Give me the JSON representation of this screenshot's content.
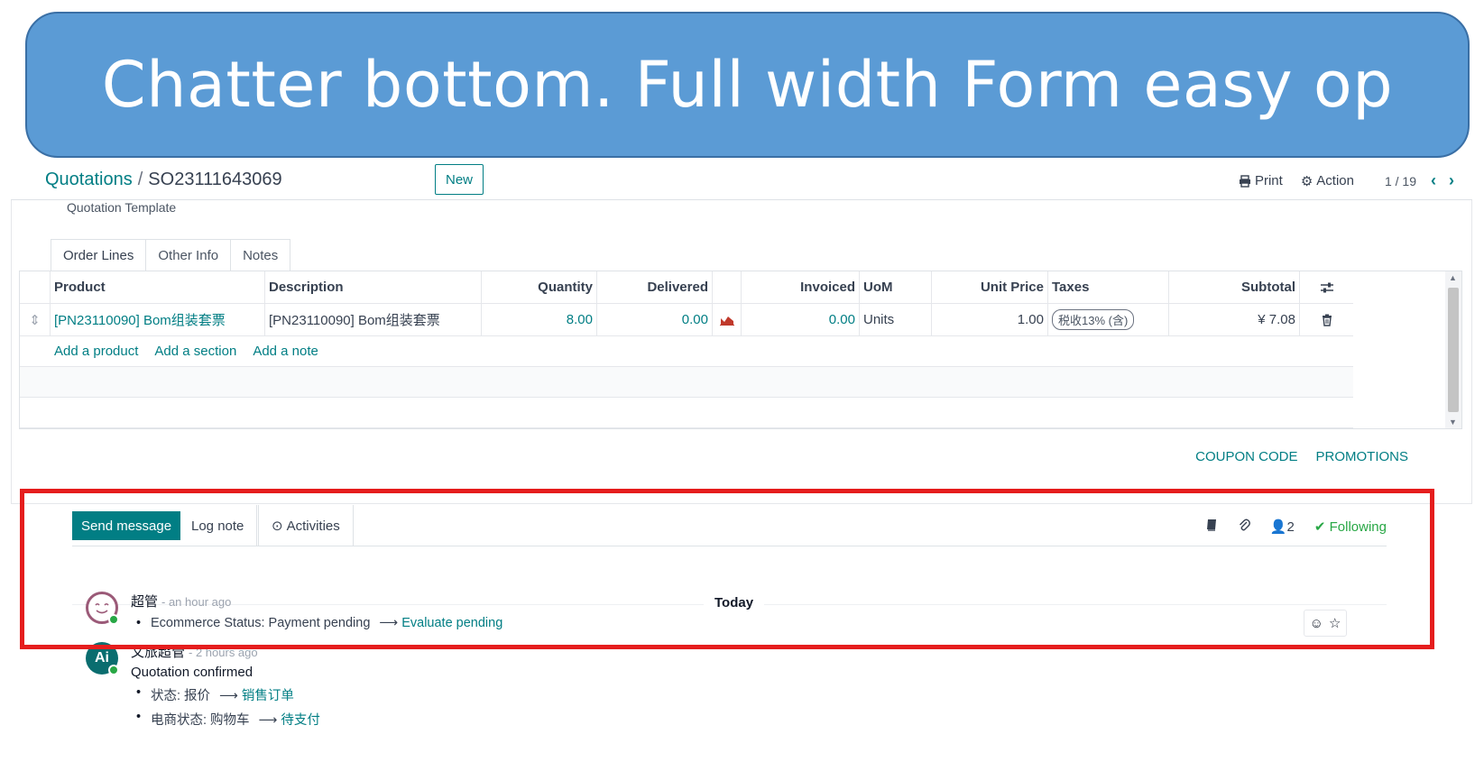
{
  "banner": {
    "text": "Chatter bottom. Full width Form easy op"
  },
  "breadcrumb": {
    "parent": "Quotations",
    "separator": "/",
    "current": "SO23111643069"
  },
  "control": {
    "new_label": "New",
    "print_label": "Print",
    "action_label": "Action",
    "pager": "1 / 19"
  },
  "form": {
    "template_label": "Quotation Template",
    "tabs": [
      {
        "label": "Order Lines",
        "active": true
      },
      {
        "label": "Other Info",
        "active": false
      },
      {
        "label": "Notes",
        "active": false
      }
    ]
  },
  "table": {
    "headers": {
      "product": "Product",
      "description": "Description",
      "quantity": "Quantity",
      "delivered": "Delivered",
      "invoiced": "Invoiced",
      "uom": "UoM",
      "unit_price": "Unit Price",
      "taxes": "Taxes",
      "subtotal": "Subtotal"
    },
    "row": {
      "product": "[PN23110090] Bom组装套票",
      "description": "[PN23110090] Bom组装套票",
      "quantity": "8.00",
      "delivered": "0.00",
      "invoiced": "0.00",
      "uom": "Units",
      "unit_price": "1.00",
      "taxes": "税收13% (含)",
      "subtotal": "¥ 7.08"
    },
    "add_links": {
      "product": "Add a product",
      "section": "Add a section",
      "note": "Add a note"
    }
  },
  "promo": {
    "coupon": "COUPON CODE",
    "promotions": "PROMOTIONS"
  },
  "chatter": {
    "send_label": "Send message",
    "log_label": "Log note",
    "activities_label": "Activities",
    "followers_count": "2",
    "following_label": "Following",
    "today_label": "Today",
    "messages": [
      {
        "author": "超管",
        "time": "- an hour ago",
        "bullet_field": "Ecommerce Status: Payment pending",
        "bullet_new": "Evaluate pending"
      },
      {
        "author": "文旅超管",
        "time": "- 2 hours ago",
        "text": "Quotation confirmed",
        "bullets": [
          {
            "field": "状态: 报价",
            "new": "销售订单"
          },
          {
            "field": "电商状态: 购物车",
            "new": "待支付"
          }
        ]
      }
    ]
  },
  "colors": {
    "accent": "#017e84",
    "banner": "#5b9bd5",
    "highlight": "#e51d1d",
    "following": "#28a745"
  }
}
